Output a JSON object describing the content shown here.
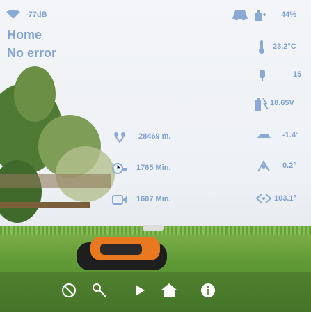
{
  "status": {
    "wifi_signal": "-77dB",
    "battery_percent": "44%",
    "location": "Home",
    "error": "No error"
  },
  "sensors": {
    "temperature": "23.2°C",
    "blade_speed": "15",
    "voltage": "18.65V",
    "pitch": "-1.4°",
    "roll": "0.2°",
    "yaw": "103.1°"
  },
  "stats": {
    "distance": "28469 m.",
    "blade_time": "1765 Min.",
    "work_time": "1607 Min."
  },
  "colors": {
    "accent": "#8aa9d4",
    "nav_icon": "#ffffff"
  },
  "nav": {
    "items": [
      {
        "icon": "zone-icon"
      },
      {
        "icon": "mow-icon"
      },
      {
        "icon": "play-icon"
      },
      {
        "icon": "home-icon"
      },
      {
        "icon": "info-icon"
      }
    ]
  }
}
